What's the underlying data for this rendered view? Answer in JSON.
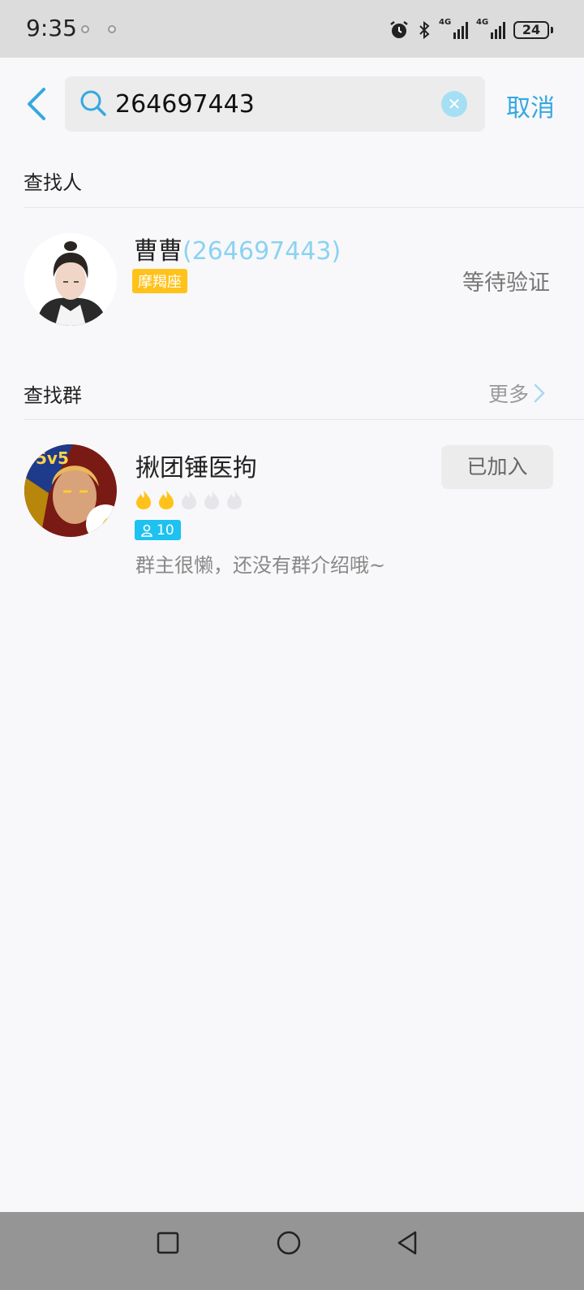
{
  "status_bar": {
    "time": "9:35",
    "net1": "4G",
    "net2": "4G",
    "battery": "24"
  },
  "search": {
    "value": "264697443",
    "cancel_label": "取消"
  },
  "people_section": {
    "title": "查找人",
    "result": {
      "name": "曹曹",
      "qq_open": "(",
      "qq": "264697443",
      "qq_close": ")",
      "zodiac": "摩羯座",
      "status": "等待验证"
    }
  },
  "group_section": {
    "title": "查找群",
    "more_label": "更多",
    "result": {
      "name": "揪团锤医拘",
      "activity_level": 2,
      "activity_max": 5,
      "members": "10",
      "description": "群主很懒，还没有群介绍哦~",
      "joined_label": "已加入"
    }
  },
  "icons": {
    "back": "chevron-left-icon",
    "search": "magnifier-icon",
    "clear": "clear-icon",
    "more": "chevron-right-icon",
    "flame": "flame-icon",
    "member": "person-icon"
  },
  "colors": {
    "accent": "#35a8e0",
    "badge_zodiac": "#ffc21a",
    "badge_member": "#1dc2f0",
    "flame_active": "#ffc21a"
  }
}
